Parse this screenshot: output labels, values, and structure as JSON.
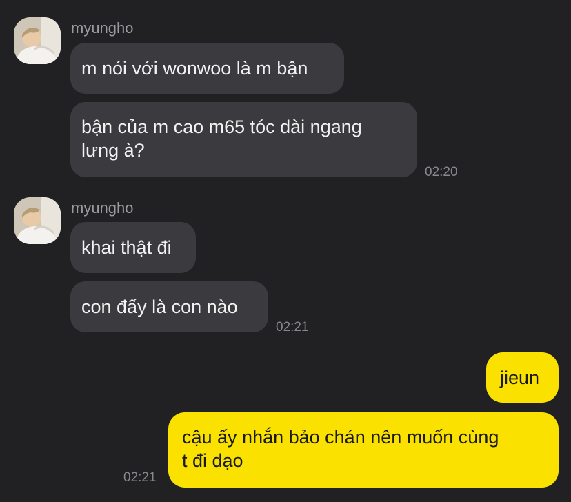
{
  "conversation": {
    "group1": {
      "sender": "myungho",
      "messages": [
        "m nói với wonwoo là m bận"
      ],
      "message2_lines": [
        "bận của m cao m65 tóc dài ngang",
        "lưng à?"
      ],
      "time": "02:20"
    },
    "group2": {
      "sender": "myungho",
      "messages": [
        "khai thật đi",
        "con đấy là con nào"
      ],
      "time": "02:21"
    },
    "group3": {
      "messages": [
        "jieun"
      ],
      "message2_lines": [
        "cậu ấy nhắn bảo chán nên muốn cùng",
        "t đi dạo"
      ],
      "time": "02:21"
    }
  },
  "colors": {
    "background": "#212124",
    "incoming_bubble": "#3b3b3f",
    "outgoing_bubble": "#fae100",
    "timestamp": "#88888d",
    "sender_name": "#9a9a9f"
  },
  "icons": {
    "avatar": "profile-photo-avatar"
  }
}
